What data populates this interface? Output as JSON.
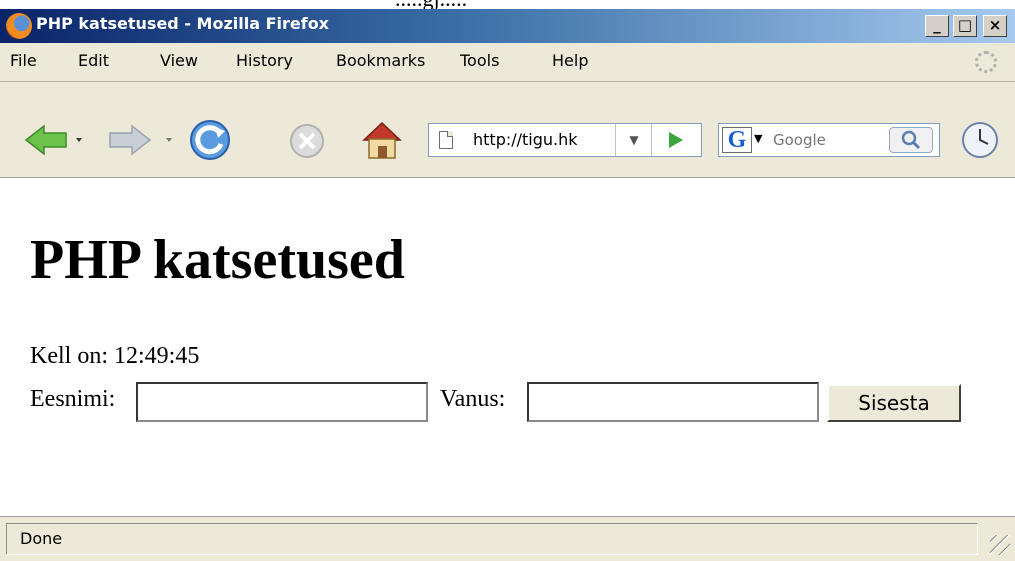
{
  "window": {
    "title": "PHP katsetused - Mozilla Firefox",
    "controls": {
      "minimize": "_",
      "maximize": "□",
      "close": "×"
    }
  },
  "menubar": {
    "items": [
      {
        "label": "File"
      },
      {
        "label": "Edit"
      },
      {
        "label": "View"
      },
      {
        "label": "History"
      },
      {
        "label": "Bookmarks"
      },
      {
        "label": "Tools"
      },
      {
        "label": "Help"
      }
    ]
  },
  "toolbar": {
    "icons": [
      "back-icon",
      "forward-icon",
      "reload-icon",
      "stop-icon",
      "home-icon",
      "history-icon"
    ],
    "url": "http://tigu.hk",
    "search": {
      "engine_glyph": "G",
      "placeholder": "Google"
    }
  },
  "page": {
    "heading": "PHP katsetused",
    "clock_line": "Kell on: 12:49:45",
    "form": {
      "name_label": "Eesnimi:",
      "name_value": "",
      "age_label": "Vanus:",
      "age_value": "",
      "submit_label": "Sisesta"
    }
  },
  "status": {
    "text": "Done"
  },
  "colors": {
    "titlebar_start": "#0a246a",
    "titlebar_end": "#a6caf0",
    "chrome": "#ece9d8",
    "go_green": "#3ea63e"
  }
}
